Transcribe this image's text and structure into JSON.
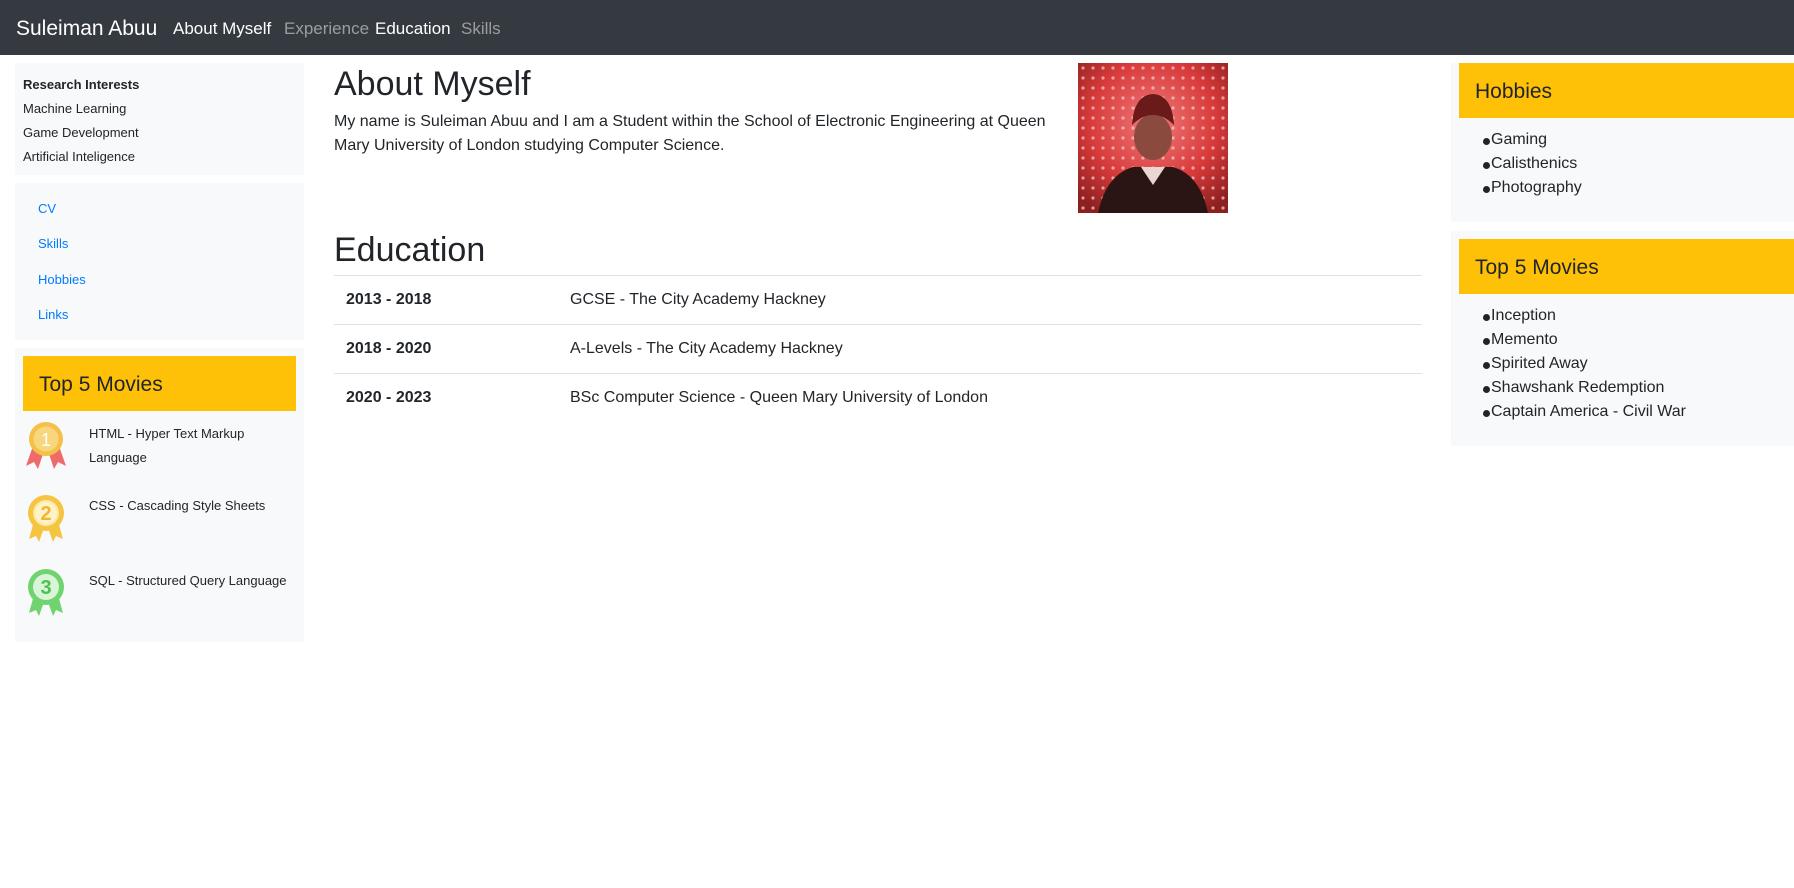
{
  "nav": {
    "brand": "Suleiman Abuu",
    "links": [
      {
        "label": "About Myself",
        "active": true
      },
      {
        "label": "Experience",
        "active": false
      },
      {
        "label": "Education",
        "active": true
      },
      {
        "label": "Skills",
        "active": false
      }
    ]
  },
  "left": {
    "research_title": "Research Interests",
    "research_items": [
      "Machine Learning",
      "Game Development",
      "Artificial Inteligence"
    ],
    "links": [
      "CV",
      "Skills",
      "Hobbies",
      "Links"
    ],
    "top5_title": "Top 5 Movies",
    "medals": [
      {
        "number": "1",
        "label": "HTML - Hyper Text Markup Language",
        "icon": "gold-medal-icon"
      },
      {
        "number": "2",
        "label": "CSS - Cascading Style Sheets",
        "icon": "yellow-medal-icon"
      },
      {
        "number": "3",
        "label": "SQL - Structured Query Language",
        "icon": "green-medal-icon"
      }
    ]
  },
  "main": {
    "about_title": "About Myself",
    "about_text": "My name is Suleiman Abuu and I am a Student within the School of Electronic Engineering at Queen Mary University of London studying Computer Science.",
    "education_title": "Education",
    "education": [
      {
        "years": "2013 - 2018",
        "desc": "GCSE - The City Academy Hackney"
      },
      {
        "years": "2018 - 2020",
        "desc": "A-Levels - The City Academy Hackney"
      },
      {
        "years": "2020 - 2023",
        "desc": "BSc Computer Science - Queen Mary University of London"
      }
    ]
  },
  "right": {
    "hobbies_title": "Hobbies",
    "hobbies": [
      "Gaming",
      "Calisthenics",
      "Photography"
    ],
    "movies_title": "Top 5 Movies",
    "movies": [
      "Inception",
      "Memento",
      "Spirited Away",
      "Shawshank Redemption",
      "Captain America - Civil War"
    ]
  },
  "colors": {
    "navbar": "#343a40",
    "accent": "#ffc107",
    "link": "#007bff",
    "panel": "#f8f9fa"
  }
}
